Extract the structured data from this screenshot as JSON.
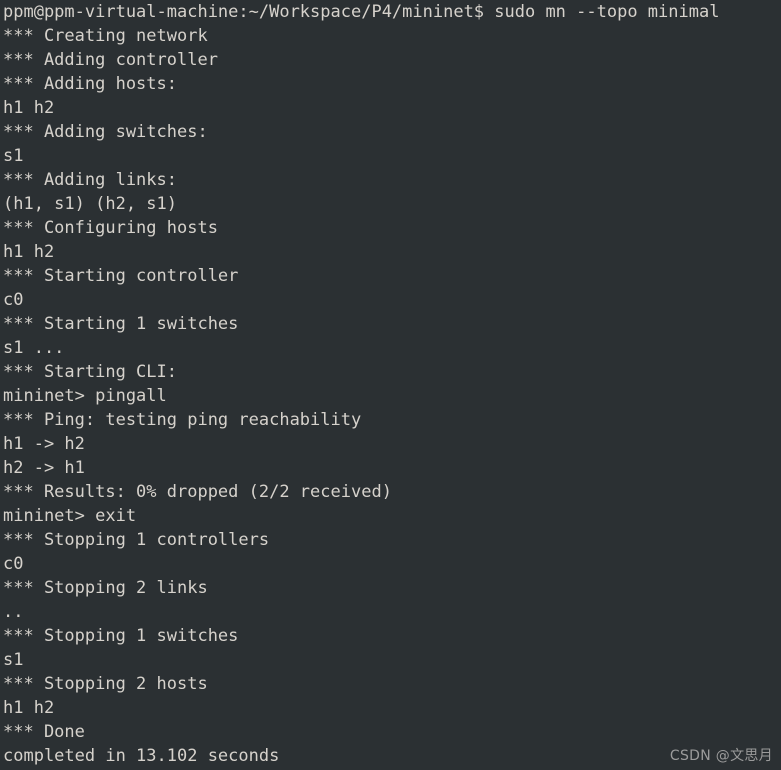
{
  "terminal": {
    "background_color": "#2b3033",
    "foreground_color": "#d6d2cc",
    "prompt": "ppm@ppm-virtual-machine:~/Workspace/P4/mininet$",
    "command": "sudo mn --topo minimal",
    "mininet_prompt_1": "mininet>",
    "mininet_command_1": "pingall",
    "mininet_prompt_2": "mininet>",
    "mininet_command_2": "exit",
    "lines": [
      "ppm@ppm-virtual-machine:~/Workspace/P4/mininet$ sudo mn --topo minimal",
      "*** Creating network",
      "*** Adding controller",
      "*** Adding hosts:",
      "h1 h2",
      "*** Adding switches:",
      "s1",
      "*** Adding links:",
      "(h1, s1) (h2, s1)",
      "*** Configuring hosts",
      "h1 h2",
      "*** Starting controller",
      "c0",
      "*** Starting 1 switches",
      "s1 ...",
      "*** Starting CLI:",
      "mininet> pingall",
      "*** Ping: testing ping reachability",
      "h1 -> h2",
      "h2 -> h1",
      "*** Results: 0% dropped (2/2 received)",
      "mininet> exit",
      "*** Stopping 1 controllers",
      "c0",
      "*** Stopping 2 links",
      "..",
      "*** Stopping 1 switches",
      "s1",
      "*** Stopping 2 hosts",
      "h1 h2",
      "*** Done",
      "completed in 13.102 seconds"
    ]
  },
  "watermark": {
    "text": "CSDN @文思月",
    "color": "#9b9b9b"
  }
}
